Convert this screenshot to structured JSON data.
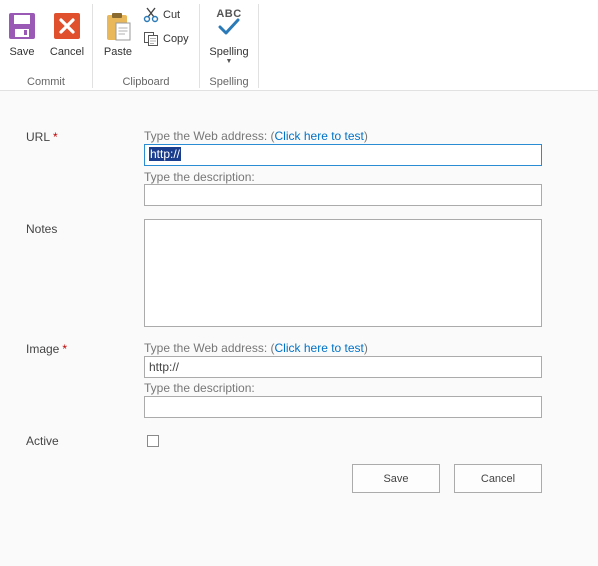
{
  "ribbon": {
    "commit": {
      "group_label": "Commit",
      "save_label": "Save",
      "cancel_label": "Cancel"
    },
    "clipboard": {
      "group_label": "Clipboard",
      "paste_label": "Paste",
      "cut_label": "Cut",
      "copy_label": "Copy"
    },
    "spelling": {
      "group_label": "Spelling",
      "spelling_label": "Spelling",
      "abc_text": "ABC"
    }
  },
  "form": {
    "url": {
      "label": "URL",
      "required_mark": "*",
      "hint_prefix": "Type the Web address: (",
      "test_link": "Click here to test",
      "hint_suffix": ")",
      "value": "http://",
      "description_hint": "Type the description:",
      "description_value": ""
    },
    "notes": {
      "label": "Notes",
      "value": ""
    },
    "image": {
      "label": "Image",
      "required_mark": "*",
      "hint_prefix": "Type the Web address: (",
      "test_link": "Click here to test",
      "hint_suffix": ")",
      "value": "http://",
      "description_hint": "Type the description:",
      "description_value": ""
    },
    "active": {
      "label": "Active",
      "checked": false
    },
    "buttons": {
      "save": "Save",
      "cancel": "Cancel"
    }
  },
  "colors": {
    "save_icon": "#9b59b6",
    "cancel_icon": "#e0502d",
    "link": "#0072c6",
    "required": "#bf0000",
    "selection": "#1a3d8e",
    "focus_border": "#2a8dd4"
  }
}
